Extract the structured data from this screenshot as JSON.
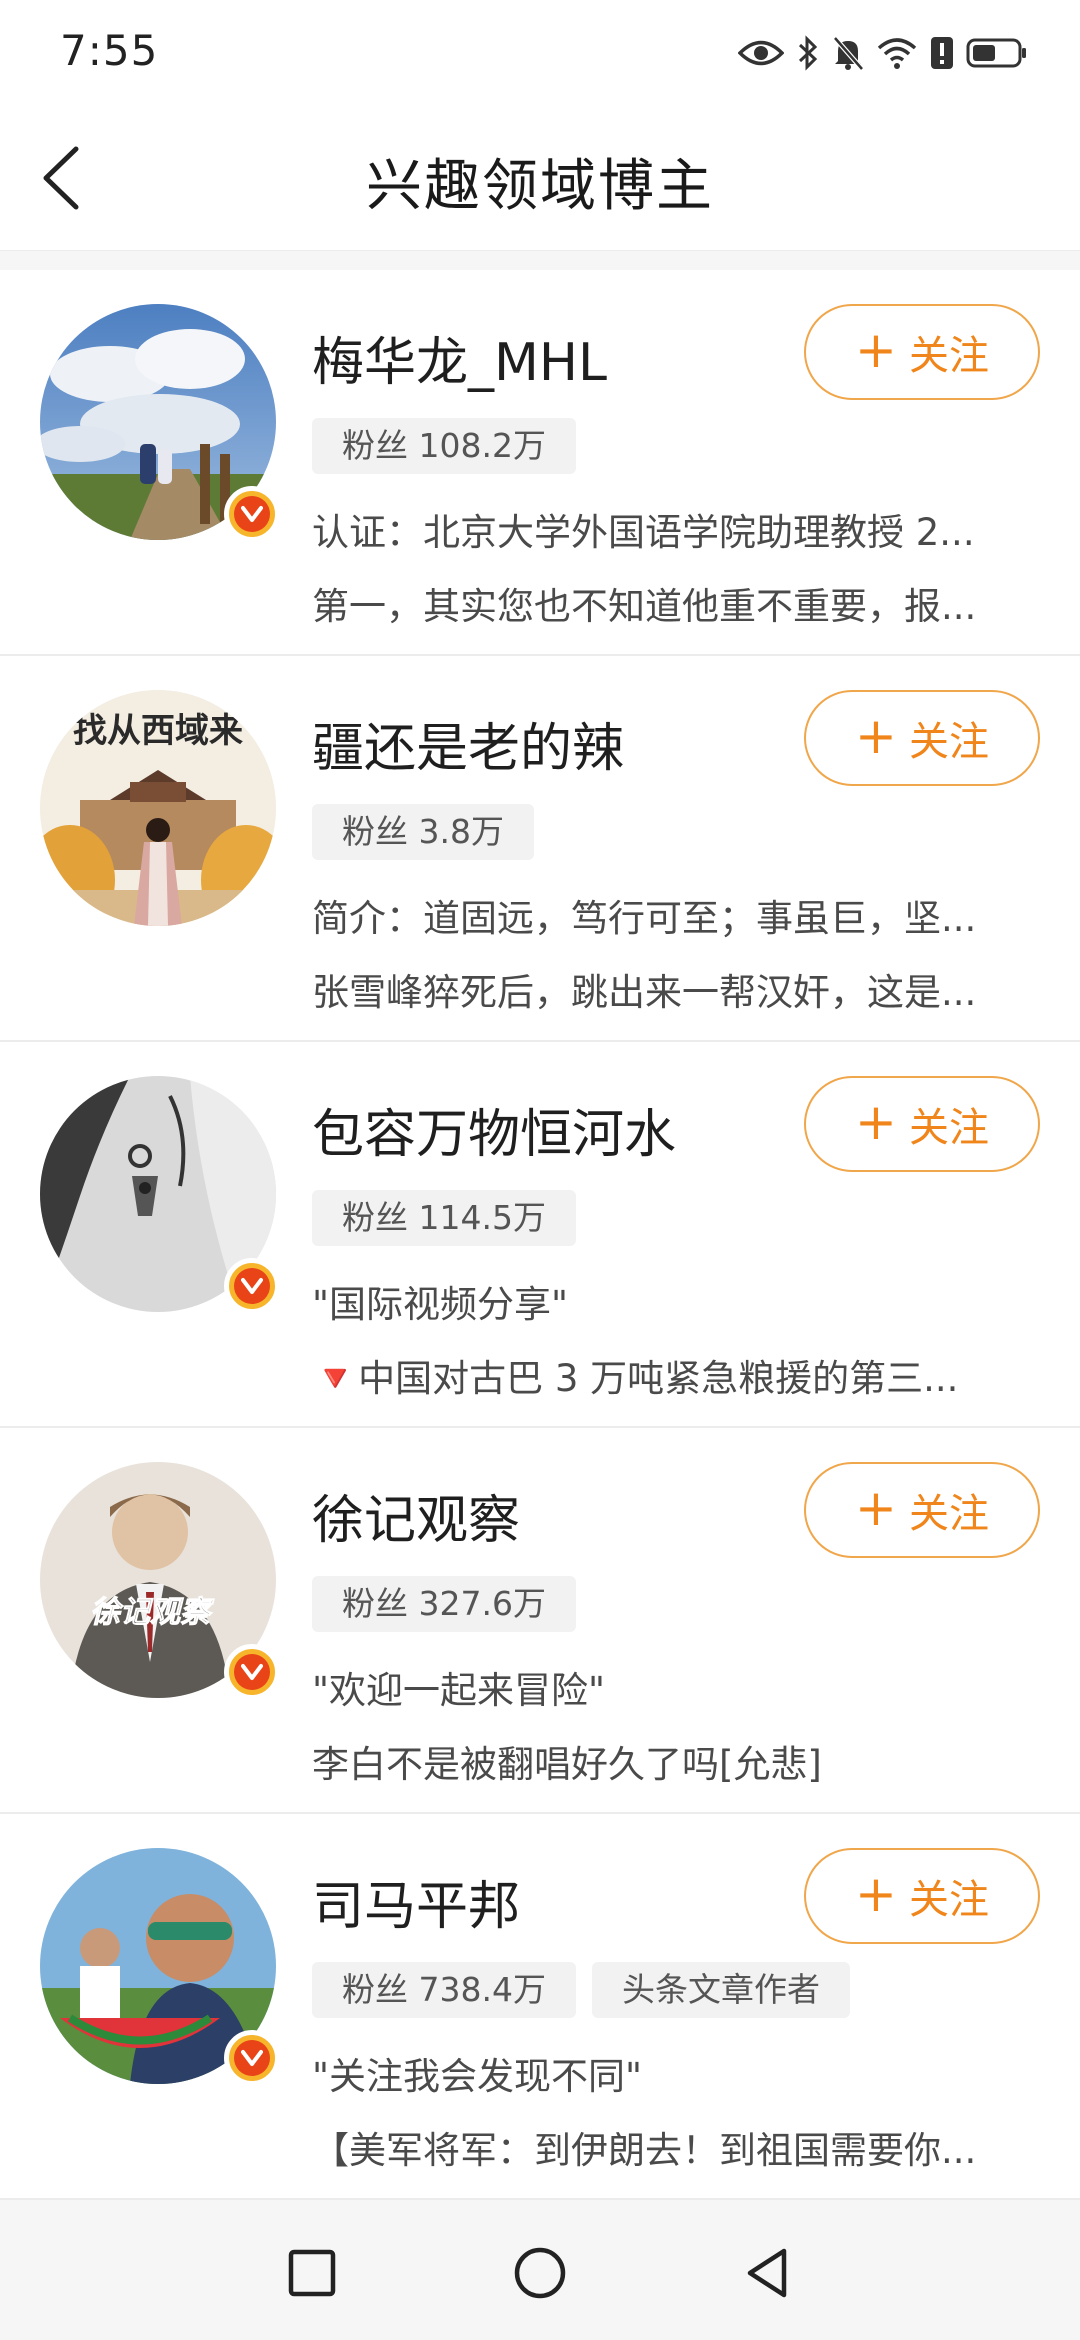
{
  "status": {
    "time": "7:55",
    "icons": [
      "eye-icon",
      "bluetooth-icon",
      "bell-muted-icon",
      "wifi-icon",
      "alert-icon",
      "battery-icon"
    ]
  },
  "header": {
    "title": "兴趣领域博主"
  },
  "follow_label": "关注",
  "colors": {
    "accent": "#f0861b",
    "follow_border": "#f0a64a",
    "verified_outer": "#f7b52c",
    "verified_inner": "#e94318"
  },
  "bloggers": [
    {
      "name": "梅华龙_MHL",
      "tags": [
        "粉丝 108.2万"
      ],
      "line1": "认证：北京大学外国语学院助理教授 2...",
      "line2": "第一，其实您也不知道他重不重要，报...",
      "verified": true,
      "avatar": "sky-bridge-photo"
    },
    {
      "name": "疆还是老的辣",
      "tags": [
        "粉丝 3.8万"
      ],
      "line1": "简介：道固远，笃行可至；事虽巨，坚...",
      "line2": "张雪峰猝死后，跳出来一帮汉奸，这是...",
      "verified": false,
      "avatar": "western-fortress-illustration"
    },
    {
      "name": "包容万物恒河水",
      "tags": [
        "粉丝 114.5万"
      ],
      "line1": "\"国际视频分享\"",
      "line2": "🔻中国对古巴 3 万吨紧急粮援的第三...",
      "verified": true,
      "avatar": "anime-sketch"
    },
    {
      "name": "徐记观察",
      "tags": [
        "粉丝 327.6万"
      ],
      "line1": "\"欢迎一起来冒险\"",
      "line2": "李白不是被翻唱好久了吗[允悲]",
      "verified": true,
      "avatar": "man-in-suit-illustration"
    },
    {
      "name": "司马平邦",
      "tags": [
        "粉丝 738.4万",
        "头条文章作者"
      ],
      "line1": "\"关注我会发现不同\"",
      "line2": "【美军将军：到伊朗去！到祖国需要你...",
      "verified": true,
      "avatar": "man-with-watermelon-photo"
    }
  ],
  "nav": {
    "icons": [
      "recent-apps-icon",
      "home-icon",
      "back-triangle-icon"
    ]
  }
}
